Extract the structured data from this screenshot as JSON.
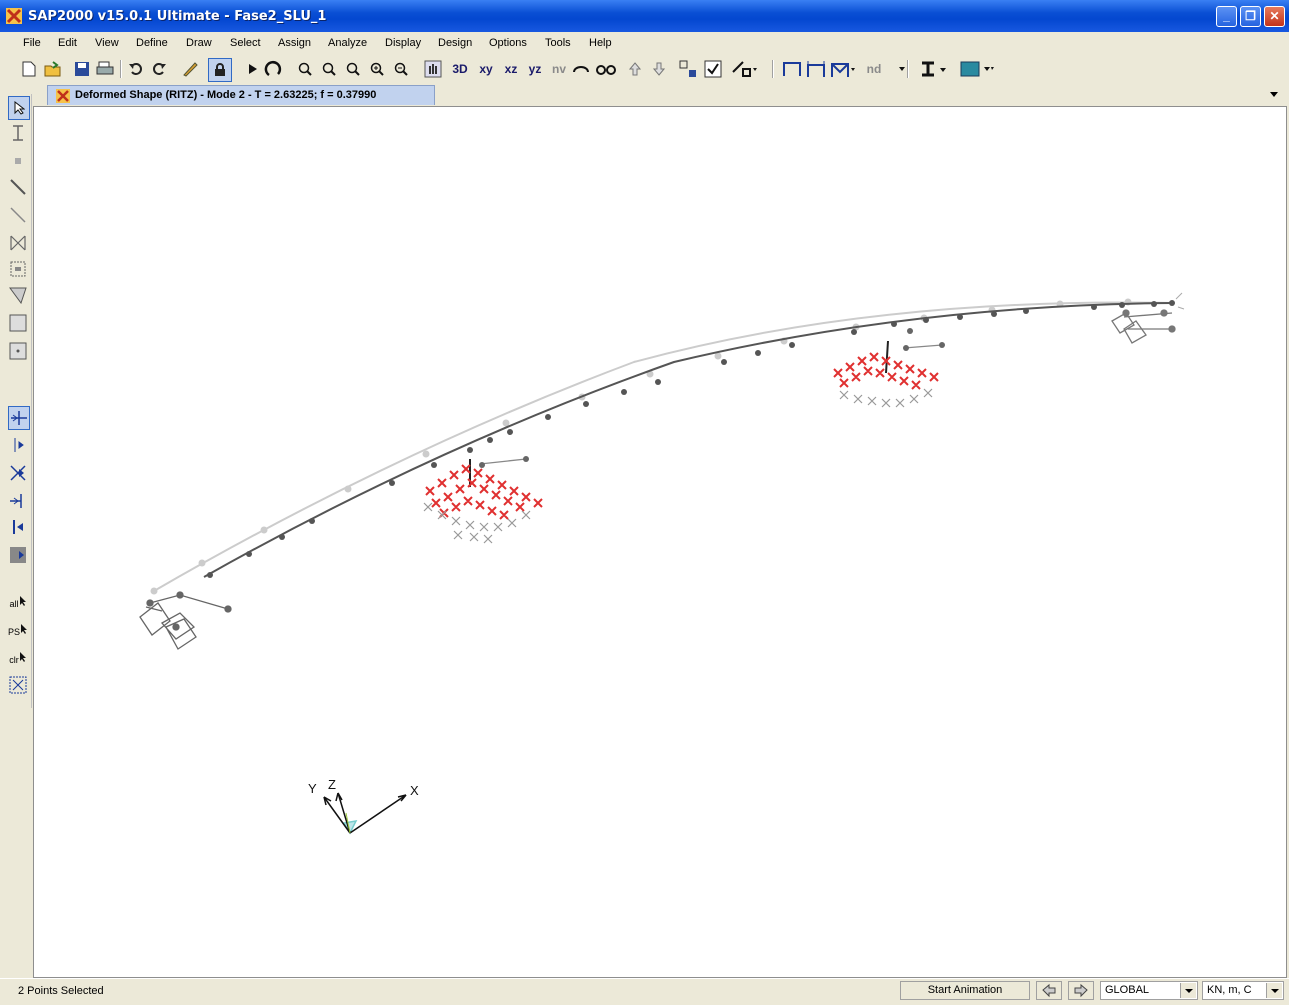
{
  "window": {
    "title": "SAP2000 v15.0.1 Ultimate  - Fase2_SLU_1",
    "minimize": "_",
    "maximize": "❐",
    "close": "✕"
  },
  "menu": [
    "File",
    "Edit",
    "View",
    "Define",
    "Draw",
    "Select",
    "Assign",
    "Analyze",
    "Display",
    "Design",
    "Options",
    "Tools",
    "Help"
  ],
  "toolbar": {
    "xy": "xy",
    "xz": "xz",
    "yz": "yz",
    "nv": "nv",
    "nd": "nd",
    "view3d": "3D"
  },
  "tab": {
    "label": "Deformed Shape (RITZ) - Mode 2 - T = 2.63225;  f = 0.37990"
  },
  "axes": {
    "x": "X",
    "y": "Y",
    "z": "Z"
  },
  "left_toolbar_labels": {
    "all": "all",
    "ps": "PS",
    "clr": "clr"
  },
  "status": {
    "text": "2 Points Selected",
    "animation_button": "Start Animation",
    "coord_system": "GLOBAL",
    "units": "KN, m, C"
  },
  "colors": {
    "title_bar": "#0a4fd4",
    "deformed": "#555555",
    "undeformed": "#c8c8c8",
    "springs": "#e03030"
  }
}
